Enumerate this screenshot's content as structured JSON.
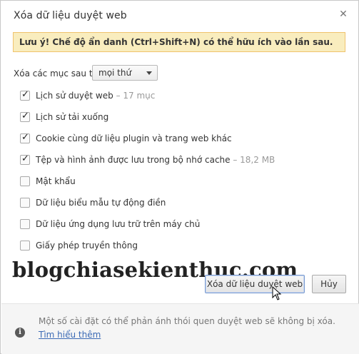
{
  "dialog": {
    "title": "Xóa dữ liệu duyệt web",
    "close_glyph": "✕"
  },
  "warning": {
    "text": "Lưu ý! Chế độ ẩn danh (Ctrl+Shift+N) có thể hữu ích vào lần sau."
  },
  "period": {
    "label": "Xóa các mục sau từ:",
    "selected": "mọi thứ"
  },
  "options": [
    {
      "label": "Lịch sử duyệt web",
      "detail": "– 17 mục",
      "checked": true
    },
    {
      "label": "Lịch sử tải xuống",
      "detail": "",
      "checked": true
    },
    {
      "label": "Cookie cùng dữ liệu plugin và trang web khác",
      "detail": "",
      "checked": true
    },
    {
      "label": "Tệp và hình ảnh được lưu trong bộ nhớ cache",
      "detail": "– 18,2 MB",
      "checked": true
    },
    {
      "label": "Mật khẩu",
      "detail": "",
      "checked": false
    },
    {
      "label": "Dữ liệu biểu mẫu tự động điền",
      "detail": "",
      "checked": false
    },
    {
      "label": "Dữ liệu ứng dụng lưu trữ trên máy chủ",
      "detail": "",
      "checked": false
    },
    {
      "label": "Giấy phép truyền thông",
      "detail": "",
      "checked": false
    }
  ],
  "watermark": "blogchiasekienthuc.com",
  "buttons": {
    "clear_label": "Xóa dữ liệu duyệt web",
    "cancel_label": "Hủy"
  },
  "footer": {
    "text": "Một số cài đặt có thể phản ánh thói quen duyệt web sẽ không bị xóa.",
    "link_text": "Tìm hiểu thêm",
    "icon": "info-icon"
  },
  "colors": {
    "warning_bg": "#f9edbe",
    "warning_border": "#f0c36d",
    "link": "#3b6ab5",
    "footer_bg": "#f5f5f5"
  }
}
